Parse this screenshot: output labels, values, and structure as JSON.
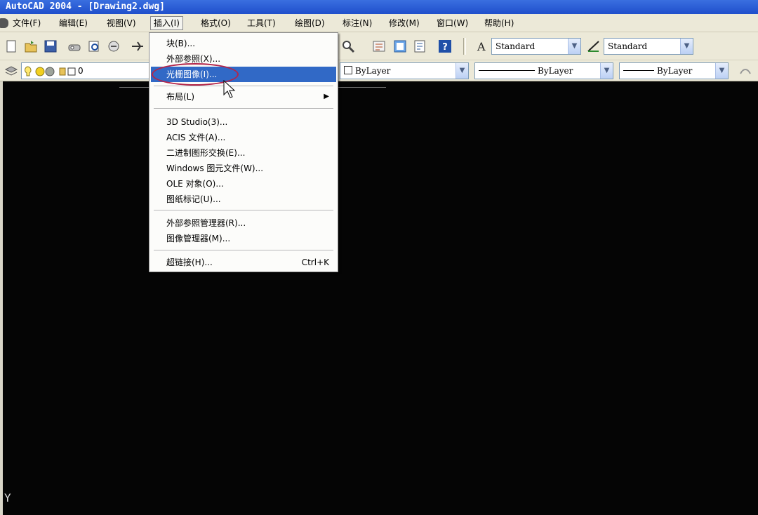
{
  "window": {
    "title": "AutoCAD 2004 - [Drawing2.dwg]"
  },
  "menubar": {
    "items": [
      {
        "label": "文件(F)"
      },
      {
        "label": "编辑(E)"
      },
      {
        "label": "视图(V)"
      },
      {
        "label": "插入(I)"
      },
      {
        "label": "格式(O)"
      },
      {
        "label": "工具(T)"
      },
      {
        "label": "绘图(D)"
      },
      {
        "label": "标注(N)"
      },
      {
        "label": "修改(M)"
      },
      {
        "label": "窗口(W)"
      },
      {
        "label": "帮助(H)"
      }
    ],
    "active_index": 3
  },
  "toolbar": {
    "text_style": "Standard",
    "dim_style": "Standard"
  },
  "properties": {
    "layer": "0",
    "color": "ByLayer",
    "linetype": "ByLayer",
    "lineweight": "ByLayer"
  },
  "insert_menu": {
    "items": [
      {
        "label": "块(B)..."
      },
      {
        "label": "外部参照(X)..."
      },
      {
        "label": "光栅图像(I)..."
      },
      {
        "label": "布局(L)"
      },
      {
        "label": "3D Studio(3)..."
      },
      {
        "label": "ACIS 文件(A)..."
      },
      {
        "label": "二进制图形交换(E)..."
      },
      {
        "label": "Windows 图元文件(W)..."
      },
      {
        "label": "OLE 对象(O)..."
      },
      {
        "label": "图纸标记(U)..."
      },
      {
        "label": "外部参照管理器(R)..."
      },
      {
        "label": "图像管理器(M)..."
      },
      {
        "label": "超链接(H)...",
        "shortcut": "Ctrl+K"
      }
    ],
    "highlighted_index": 2
  },
  "drawing": {
    "axis_label": "Y"
  },
  "colors": {
    "title_bar": "#2459d6",
    "menu_highlight": "#3169c6",
    "drawing_background": "#050505",
    "annotation_circle": "#b3264b"
  }
}
